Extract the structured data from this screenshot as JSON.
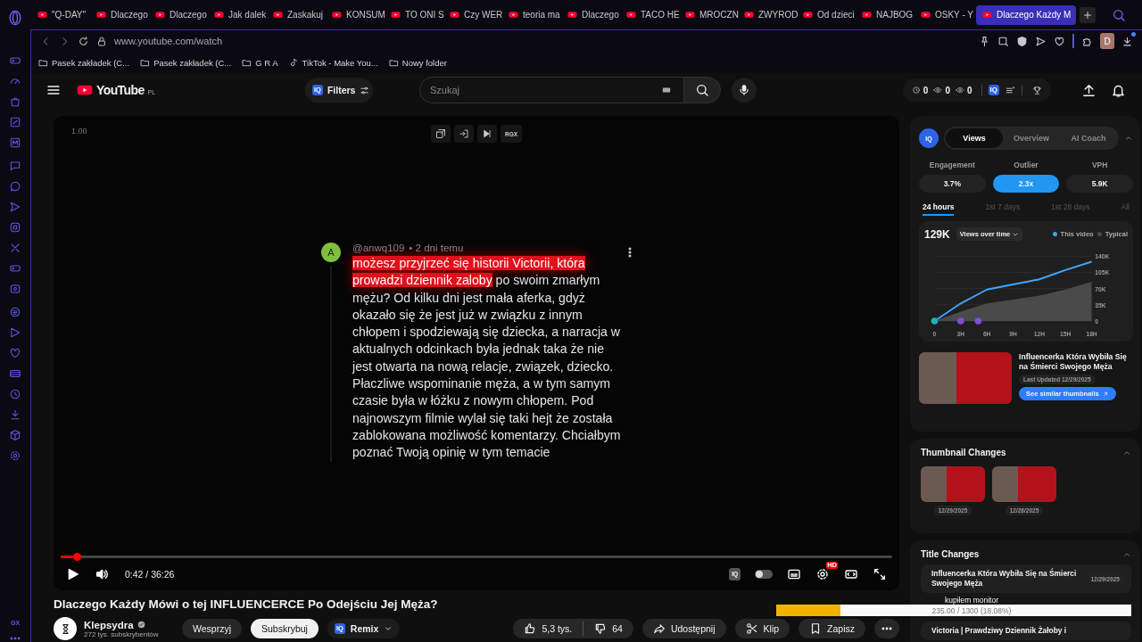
{
  "browser": {
    "tabs": [
      {
        "title": "\"Q-DAY\"",
        "selected": false
      },
      {
        "title": "Dlaczego",
        "selected": false
      },
      {
        "title": "Dlaczego",
        "selected": false
      },
      {
        "title": "Jak dalek",
        "selected": false
      },
      {
        "title": "Zaskakuj",
        "selected": false
      },
      {
        "title": "KONSUM",
        "selected": false
      },
      {
        "title": "TO ONI S",
        "selected": false
      },
      {
        "title": "Czy WER",
        "selected": false
      },
      {
        "title": "teoria ma",
        "selected": false
      },
      {
        "title": "Dlaczego",
        "selected": false
      },
      {
        "title": "TACO HE",
        "selected": false
      },
      {
        "title": "MROCZN",
        "selected": false
      },
      {
        "title": "ZWYROD",
        "selected": false
      },
      {
        "title": "Od dzieci",
        "selected": false
      },
      {
        "title": "NAJBOG",
        "selected": false
      },
      {
        "title": "OSKY - Y",
        "selected": false
      },
      {
        "title": "Dlaczego Każdy M",
        "selected": true
      }
    ],
    "url": "www.youtube.com/watch",
    "profile_initial": "D",
    "bookmarks": [
      {
        "kind": "folder",
        "label": "Pasek zakładek (C..."
      },
      {
        "kind": "folder",
        "label": "Pasek zakładek (C..."
      },
      {
        "kind": "folder",
        "label": "G R A"
      },
      {
        "kind": "tiktok",
        "label": "TikTok - Make You..."
      },
      {
        "kind": "folder",
        "label": "Nowy folder"
      }
    ],
    "sidebar_label": "GX"
  },
  "header": {
    "logo": "YouTube",
    "region": "PL",
    "filters": {
      "badge": "IQ",
      "label": "Filters"
    },
    "search": {
      "placeholder": "Szukaj"
    },
    "stats": [
      {
        "kind": "clock",
        "value": "0"
      },
      {
        "kind": "eye",
        "value": "0"
      },
      {
        "kind": "eye",
        "value": "0"
      }
    ],
    "stats_badge": "IQ"
  },
  "player": {
    "speed": "1.00",
    "tools": [
      {
        "kind": "popout"
      },
      {
        "kind": "enter"
      },
      {
        "kind": "skip"
      },
      {
        "kind": "text",
        "label": "RGX"
      }
    ],
    "comment": {
      "avatar": "A",
      "author": "@anwq109",
      "time": "• 2 dni temu",
      "highlight": "możesz przyjrzeć się historii Victorii, która prowadzi dziennik zaloby",
      "text": " po swoim zmarłym mężu? Od kilku dni jest mała aferka, gdyż okazało się że jest już w związku z innym chłopem i spodziewają się dziecka, a narracja w aktualnych odcinkach była jednak taka że nie jest otwarta na nową relacje, związek, dziecko. Płaczliwe wspominanie męża, a w tym samym czasie była w łóżku z nowym chłopem. Pod najnowszym filmie wylał się taki hejt że została zablokowana możliwość komentarzy. Chciałbym poznać Twoją opinię w tym temacie"
    },
    "progress": {
      "level": 0.019
    },
    "time": "0:42 / 36:26",
    "badge": "IQ",
    "autoplay": {
      "on": false
    },
    "settings_badge": "HD"
  },
  "video": {
    "title": "Dlaczego Każdy Mówi o tej INFLUENCERCE Po Odejściu Jej Męża?",
    "channel": {
      "name": "Klepsydra",
      "verified": true,
      "subscribers": "272 tys. subskrybentów"
    },
    "support": "Wesprzyj",
    "subscribe": "Subskrybuj",
    "remix": {
      "badge": "IQ",
      "label": "Remix"
    },
    "likes": "5,3 tys.",
    "dislikes": "64",
    "share": "Udostępnij",
    "clip": "Klip",
    "save": "Zapisz"
  },
  "panel": {
    "badge": "IQ",
    "tabs": [
      {
        "label": "Views",
        "selected": true
      },
      {
        "label": "Overview",
        "selected": false
      },
      {
        "label": "AI Coach",
        "selected": false
      }
    ],
    "metrics": [
      {
        "label": "Engagement",
        "value": "3.7%",
        "selected": false
      },
      {
        "label": "Outlier",
        "value": "2.3x",
        "selected": true
      },
      {
        "label": "VPH",
        "value": "5.9K",
        "selected": false
      }
    ],
    "ranges": [
      {
        "label": "24 hours",
        "selected": true
      },
      {
        "label": "1st 7 days",
        "selected": false
      },
      {
        "label": "1st 28 days",
        "selected": false
      },
      {
        "label": "All",
        "selected": false
      }
    ],
    "total": "129K",
    "dropdown": "Views over time",
    "chart_data": {
      "type": "line",
      "x": [
        0,
        3,
        6,
        9,
        12,
        15,
        18
      ],
      "series": [
        {
          "name": "This video",
          "color": "#3ea6ff",
          "values": [
            0,
            38000,
            68000,
            79000,
            90000,
            110000,
            128000
          ]
        },
        {
          "name": "Typical",
          "type": "area",
          "color": "#4a4a4a",
          "values": [
            0,
            20000,
            38000,
            46000,
            55000,
            68000,
            85000
          ]
        }
      ],
      "xlim": [
        0,
        18
      ],
      "ylim": [
        0,
        140000
      ],
      "grid": true,
      "xticks": [
        {
          "value": 0,
          "label": "0"
        },
        {
          "value": 3,
          "label": "3H"
        },
        {
          "value": 6,
          "label": "6H"
        },
        {
          "value": 9,
          "label": "9H"
        },
        {
          "value": 12,
          "label": "12H"
        },
        {
          "value": 15,
          "label": "15H"
        },
        {
          "value": 18,
          "label": "18H"
        }
      ],
      "yticks": [
        {
          "value": 0,
          "label": "0"
        },
        {
          "value": 35000,
          "label": "35K"
        },
        {
          "value": 70000,
          "label": "70K"
        },
        {
          "value": 105000,
          "label": "105K"
        },
        {
          "value": 140000,
          "label": "140K"
        }
      ]
    },
    "thumbnail": {
      "title": "Influencerka Która Wybiła Się na Śmierci Swojego Męża",
      "updated": "Last Updated 12/29/2025",
      "button": "See similar thumbnails"
    },
    "thumbnail_changes": {
      "title": "Thumbnail Changes",
      "expanded": true,
      "items": [
        {
          "date": "12/29/2025"
        },
        {
          "date": "12/28/2025"
        }
      ]
    },
    "title_changes": {
      "title": "Title Changes",
      "expanded": true,
      "items": [
        {
          "title": "Influencerka Która Wybiła Się na Śmierci Swojego Męża",
          "date": "12/29/2025"
        },
        {
          "title": "Victoria | Prawdziwy Dziennik Żałoby i"
        }
      ]
    }
  },
  "goal": {
    "label": "kupiłem monitor",
    "reading": "235.00 / 1300 (18.08%)",
    "level": 0.1808
  }
}
